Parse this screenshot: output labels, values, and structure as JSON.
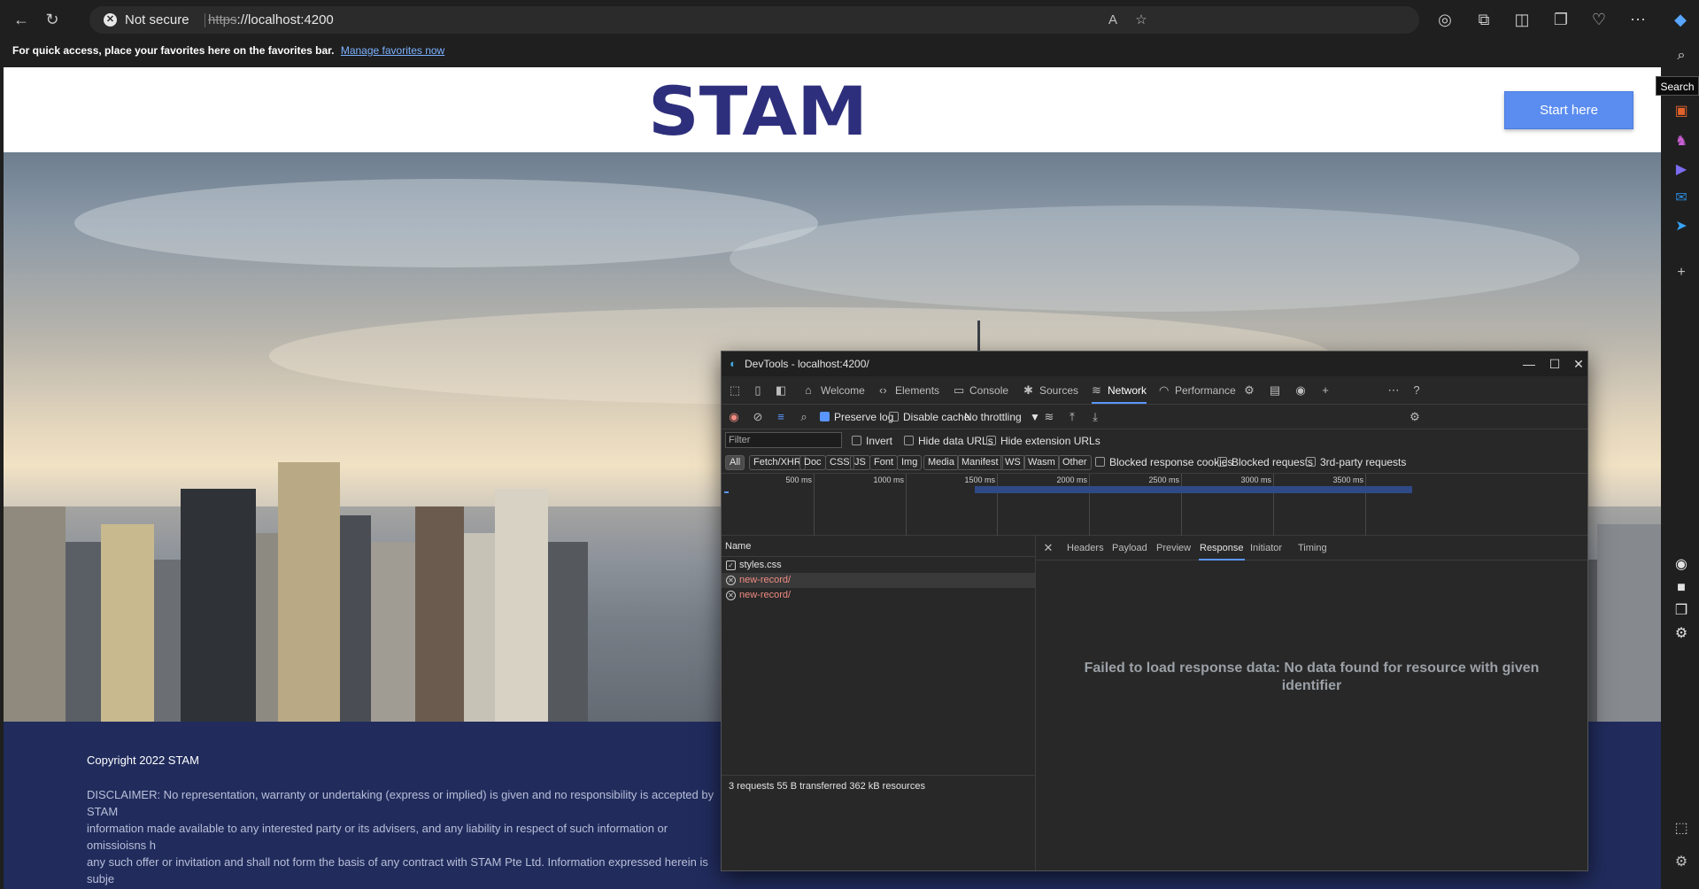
{
  "browser": {
    "security_text": "Not secure",
    "url_scheme": "https",
    "url_rest": "://localhost:4200",
    "favorites_text": "For quick access, place your favorites here on the favorites bar.",
    "favorites_link": "Manage favorites now",
    "search_tooltip": "Search"
  },
  "site": {
    "logo_text": "STAM",
    "start_button": "Start here",
    "copyright": "Copyright 2022 STAM",
    "disclaimer": "DISCLAIMER: No representation, warranty or undertaking (express or implied) is given and no responsibility is accepted by STAM\ninformation made available to any interested party or its advisers, and any liability in respect of such information or omissioisns h\nany such offer or invitation and shall not form the basis of any contract with STAM Pte Ltd. Information expressed herein is subje\nany inaccuracies or omissions which may become apparent."
  },
  "devtools": {
    "title": "DevTools - localhost:4200/",
    "tabs": [
      "Welcome",
      "Elements",
      "Console",
      "Sources",
      "Network",
      "Performance"
    ],
    "toolbar": {
      "preserve_log": "Preserve log",
      "disable_cache": "Disable cache",
      "throttling": "No throttling"
    },
    "filter": {
      "placeholder": "Filter",
      "invert": "Invert",
      "hide_data_urls": "Hide data URLs",
      "hide_extension_urls": "Hide extension URLs"
    },
    "types": [
      "All",
      "Fetch/XHR",
      "Doc",
      "CSS",
      "JS",
      "Font",
      "Img",
      "Media",
      "Manifest",
      "WS",
      "Wasm",
      "Other"
    ],
    "type_checks": {
      "blocked_cookies": "Blocked response cookies",
      "blocked_requests": "Blocked requests",
      "third_party": "3rd-party requests"
    },
    "timeline_ticks": [
      "500 ms",
      "1000 ms",
      "1500 ms",
      "2000 ms",
      "2500 ms",
      "3000 ms",
      "3500 ms"
    ],
    "name_header": "Name",
    "requests": [
      {
        "name": "styles.css",
        "status": "ok"
      },
      {
        "name": "new-record/",
        "status": "error"
      },
      {
        "name": "new-record/",
        "status": "error"
      }
    ],
    "status_bar": "3 requests  55 B transferred  362 kB resources",
    "detail_tabs": [
      "Headers",
      "Payload",
      "Preview",
      "Response",
      "Initiator",
      "Timing"
    ],
    "response_message": "Failed to load response data: No data found for resource with given identifier"
  },
  "colors": {
    "accent": "#5a96ff",
    "error": "#f28b82",
    "brand_navy": "#212c5d",
    "start_button": "#5b8df0"
  }
}
